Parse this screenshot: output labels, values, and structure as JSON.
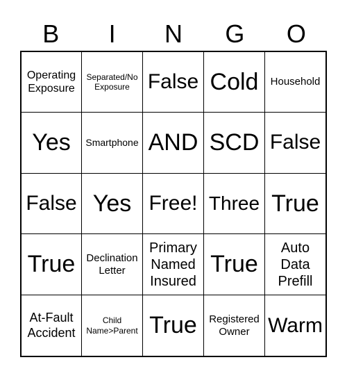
{
  "header": [
    "B",
    "I",
    "N",
    "G",
    "O"
  ],
  "cells": [
    "Operating Exposure",
    "Separated/No Exposure",
    "False",
    "Cold",
    "Household",
    "Yes",
    "Smartphone",
    "AND",
    "SCD",
    "False",
    "False",
    "Yes",
    "Free!",
    "Three",
    "True",
    "True",
    "Declination Letter",
    "Primary Named Insured",
    "True",
    "Auto Data Prefill",
    "At-Fault Accident",
    "Child Name>Parent",
    "True",
    "Registered Owner",
    "Warm"
  ]
}
